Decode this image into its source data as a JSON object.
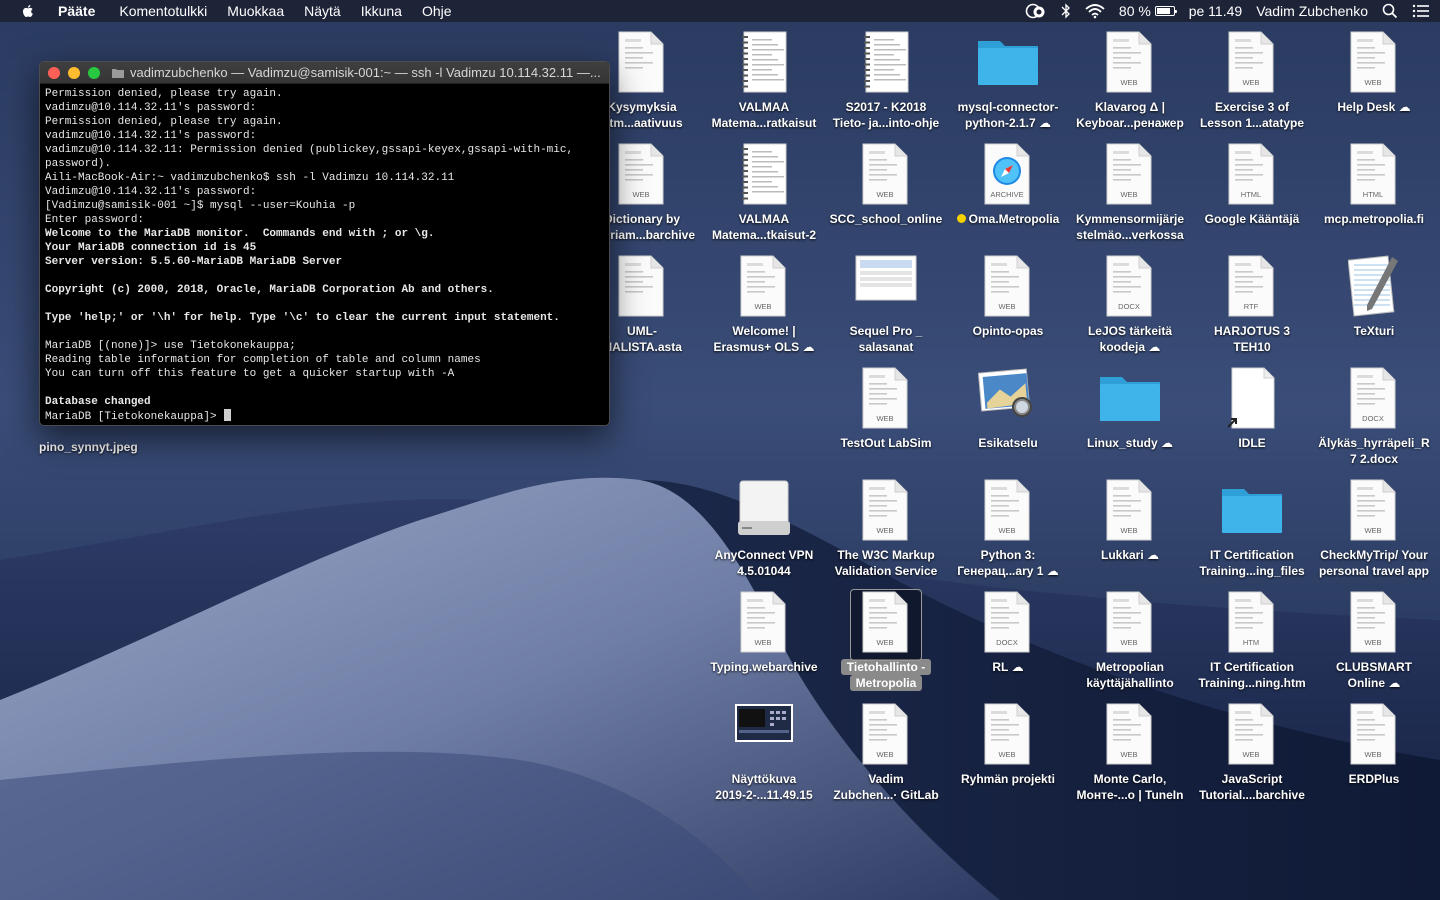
{
  "menubar": {
    "app_name": "Pääte",
    "menus": [
      "Komentotulkki",
      "Muokkaa",
      "Näytä",
      "Ikkuna",
      "Ohje"
    ],
    "battery_percent_label": "80 %",
    "battery_level": 0.8,
    "clock": "pe 11.49",
    "user_name": "Vadim Zubchenko"
  },
  "terminal": {
    "title": "vadimzubchenko — Vadimzu@samisik-001:~ — ssh -l Vadimzu 10.114.32.11 —...",
    "lines": [
      {
        "text": "Permission denied, please try again.",
        "bold": false
      },
      {
        "text": "vadimzu@10.114.32.11's password:",
        "bold": false
      },
      {
        "text": "Permission denied, please try again.",
        "bold": false
      },
      {
        "text": "vadimzu@10.114.32.11's password:",
        "bold": false
      },
      {
        "text": "vadimzu@10.114.32.11: Permission denied (publickey,gssapi-keyex,gssapi-with-mic,",
        "bold": false
      },
      {
        "text": "password).",
        "bold": false
      },
      {
        "text": "Aili-MacBook-Air:~ vadimzubchenko$ ssh -l Vadimzu 10.114.32.11",
        "bold": false
      },
      {
        "text": "Vadimzu@10.114.32.11's password:",
        "bold": false
      },
      {
        "text": "[Vadimzu@samisik-001 ~]$ mysql --user=Kouhia -p",
        "bold": false
      },
      {
        "text": "Enter password:",
        "bold": false
      },
      {
        "text": "Welcome to the MariaDB monitor.  Commands end with ; or \\g.",
        "bold": true
      },
      {
        "text": "Your MariaDB connection id is 45",
        "bold": true
      },
      {
        "text": "Server version: 5.5.60-MariaDB MariaDB Server",
        "bold": true
      },
      {
        "text": "",
        "bold": false
      },
      {
        "text": "Copyright (c) 2000, 2018, Oracle, MariaDB Corporation Ab and others.",
        "bold": true
      },
      {
        "text": "",
        "bold": false
      },
      {
        "text": "Type 'help;' or '\\h' for help. Type '\\c' to clear the current input statement.",
        "bold": true
      },
      {
        "text": "",
        "bold": false
      },
      {
        "text": "MariaDB [(none)]> use Tietokonekauppa;",
        "bold": false
      },
      {
        "text": "Reading table information for completion of table and column names",
        "bold": false
      },
      {
        "text": "You can turn off this feature to get a quicker startup with -A",
        "bold": false
      },
      {
        "text": "",
        "bold": false
      },
      {
        "text": "Database changed",
        "bold": true
      }
    ],
    "prompt": "MariaDB [Tietokonekauppa]> "
  },
  "loose_file_label": "pino_synnyt.jpeg",
  "desktop_icons": [
    {
      "id": "kysymyksia",
      "type": "doc",
      "badge": "",
      "lines": [
        "Kysymyksia",
        "ritm...aativuus"
      ],
      "cloud": false
    },
    {
      "id": "valmaa1",
      "type": "notebook",
      "badge": "",
      "lines": [
        "VALMAA",
        "Matema...ratkaisut"
      ],
      "cloud": false
    },
    {
      "id": "s2017",
      "type": "notebook",
      "badge": "",
      "lines": [
        "S2017 - K2018",
        "Tieto- ja...into-ohje"
      ],
      "cloud": false
    },
    {
      "id": "mysql-connector",
      "type": "folder",
      "badge": "",
      "lines": [
        "mysql-connector-",
        "python-2.1.7"
      ],
      "cloud": true
    },
    {
      "id": "klavarog",
      "type": "web",
      "badge": "WEB",
      "lines": [
        "Klavarog Δ |",
        "Keyboar...ренажер"
      ],
      "cloud": false
    },
    {
      "id": "exercise3",
      "type": "web",
      "badge": "WEB",
      "lines": [
        "Exercise 3 of",
        "Lesson 1...atatype"
      ],
      "cloud": false
    },
    {
      "id": "helpdesk",
      "type": "web",
      "badge": "WEB",
      "lines": [
        "Help Desk"
      ],
      "cloud": true
    },
    {
      "id": "dictionary",
      "type": "web",
      "badge": "WEB",
      "lines": [
        "Dictionary by",
        "Merriam...barchive"
      ],
      "cloud": false
    },
    {
      "id": "valmaa2",
      "type": "notebook",
      "badge": "",
      "lines": [
        "VALMAA",
        "Matema...tkaisut-2"
      ],
      "cloud": false
    },
    {
      "id": "scc",
      "type": "web",
      "badge": "WEB",
      "lines": [
        "SCC_school_online"
      ],
      "cloud": false
    },
    {
      "id": "oma",
      "type": "safari",
      "badge": "ARCHIVE",
      "lines": [
        "Oma.Metropolia"
      ],
      "cloud": false,
      "dot": true
    },
    {
      "id": "kymmensormi",
      "type": "web",
      "badge": "WEB",
      "lines": [
        "Kymmensormijärje",
        "stelmäo...verkossa"
      ],
      "cloud": false
    },
    {
      "id": "google-kaantaja",
      "type": "web",
      "badge": "HTML",
      "lines": [
        "Google Kääntäjä"
      ],
      "cloud": false
    },
    {
      "id": "mcp",
      "type": "web",
      "badge": "HTML",
      "lines": [
        "mcp.metropolia.fi"
      ],
      "cloud": false
    },
    {
      "id": "uml",
      "type": "doc",
      "badge": "",
      "lines": [
        "UML-",
        "MALISTA.asta"
      ],
      "cloud": false
    },
    {
      "id": "welcome",
      "type": "web",
      "badge": "WEB",
      "lines": [
        "Welcome! |",
        "Erasmus+ OLS"
      ],
      "cloud": true
    },
    {
      "id": "sequelpro",
      "type": "app",
      "badge": "",
      "lines": [
        "Sequel Pro _",
        "salasanat"
      ],
      "cloud": false
    },
    {
      "id": "opinto",
      "type": "web",
      "badge": "WEB",
      "lines": [
        "Opinto-opas"
      ],
      "cloud": false
    },
    {
      "id": "lejos",
      "type": "web",
      "badge": "DOCX",
      "lines": [
        "LeJOS tärkeitä",
        "koodeja"
      ],
      "cloud": true
    },
    {
      "id": "harjotus3",
      "type": "web",
      "badge": "RTF",
      "lines": [
        "HARJOTUS 3",
        "TEH10"
      ],
      "cloud": false
    },
    {
      "id": "texturi",
      "type": "texturi",
      "badge": "",
      "lines": [
        "TeXturi"
      ],
      "cloud": false
    },
    {
      "id": "testout",
      "type": "web",
      "badge": "WEB",
      "lines": [
        "TestOut LabSim"
      ],
      "cloud": false
    },
    {
      "id": "esikatselu",
      "type": "preview",
      "badge": "",
      "lines": [
        "Esikatselu"
      ],
      "cloud": false
    },
    {
      "id": "linux",
      "type": "folder",
      "badge": "",
      "lines": [
        "Linux_study"
      ],
      "cloud": true
    },
    {
      "id": "idle",
      "type": "alias",
      "badge": "",
      "lines": [
        "IDLE"
      ],
      "cloud": false
    },
    {
      "id": "alykas",
      "type": "web",
      "badge": "DOCX",
      "lines": [
        "Älykäs_hyrräpeli_R",
        "7 2.docx"
      ],
      "cloud": false
    },
    {
      "id": "anyconnect",
      "type": "drive",
      "badge": "",
      "lines": [
        "AnyConnect VPN",
        "4.5.01044"
      ],
      "cloud": false
    },
    {
      "id": "w3c",
      "type": "web",
      "badge": "WEB",
      "lines": [
        "The W3C Markup",
        "Validation Service"
      ],
      "cloud": false
    },
    {
      "id": "python3",
      "type": "web",
      "badge": "WEB",
      "lines": [
        "Python 3:",
        "Генерац...ary 1"
      ],
      "cloud": true
    },
    {
      "id": "lukkari",
      "type": "web",
      "badge": "WEB",
      "lines": [
        "Lukkari"
      ],
      "cloud": true
    },
    {
      "id": "itcert-files",
      "type": "folder",
      "badge": "",
      "lines": [
        "IT Certification",
        "Training...ing_files"
      ],
      "cloud": false
    },
    {
      "id": "checkmytrip",
      "type": "web",
      "badge": "WEB",
      "lines": [
        "CheckMyTrip/ Your",
        "personal travel app"
      ],
      "cloud": false
    },
    {
      "id": "typing",
      "type": "web",
      "badge": "WEB",
      "lines": [
        "Typing.webarchive"
      ],
      "cloud": false
    },
    {
      "id": "tietohallinto",
      "type": "web",
      "badge": "WEB",
      "lines": [
        "Tietohallinto -",
        "Metropolia"
      ],
      "cloud": false,
      "selected": true
    },
    {
      "id": "rl",
      "type": "web",
      "badge": "DOCX",
      "lines": [
        "RL"
      ],
      "cloud": true
    },
    {
      "id": "metropolian",
      "type": "web",
      "badge": "WEB",
      "lines": [
        "Metropolian",
        "käyttäjähallinto"
      ],
      "cloud": false
    },
    {
      "id": "itcert-htm",
      "type": "web",
      "badge": "HTM",
      "lines": [
        "IT Certification",
        "Training...ning.htm"
      ],
      "cloud": false
    },
    {
      "id": "clubsmart",
      "type": "web",
      "badge": "WEB",
      "lines": [
        "CLUBSMART",
        "Online"
      ],
      "cloud": true
    },
    {
      "id": "nayttokuva",
      "type": "screenshot",
      "badge": "",
      "lines": [
        "Näyttökuva",
        "2019-2-...11.49.15"
      ],
      "cloud": false
    },
    {
      "id": "vadim-gitlab",
      "type": "web",
      "badge": "WEB",
      "lines": [
        "Vadim",
        "Zubchen...· GitLab"
      ],
      "cloud": false
    },
    {
      "id": "ryhman",
      "type": "web",
      "badge": "WEB",
      "lines": [
        "Ryhmän projekti"
      ],
      "cloud": false
    },
    {
      "id": "montecarlo",
      "type": "web",
      "badge": "WEB",
      "lines": [
        "Monte Carlo,",
        "Монте-...o | TuneIn"
      ],
      "cloud": false
    },
    {
      "id": "jstutorial",
      "type": "web",
      "badge": "WEB",
      "lines": [
        "JavaScript",
        "Tutorial....barchive"
      ],
      "cloud": false
    },
    {
      "id": "erdplus",
      "type": "web",
      "badge": "WEB",
      "lines": [
        "ERDPlus"
      ],
      "cloud": false
    }
  ]
}
